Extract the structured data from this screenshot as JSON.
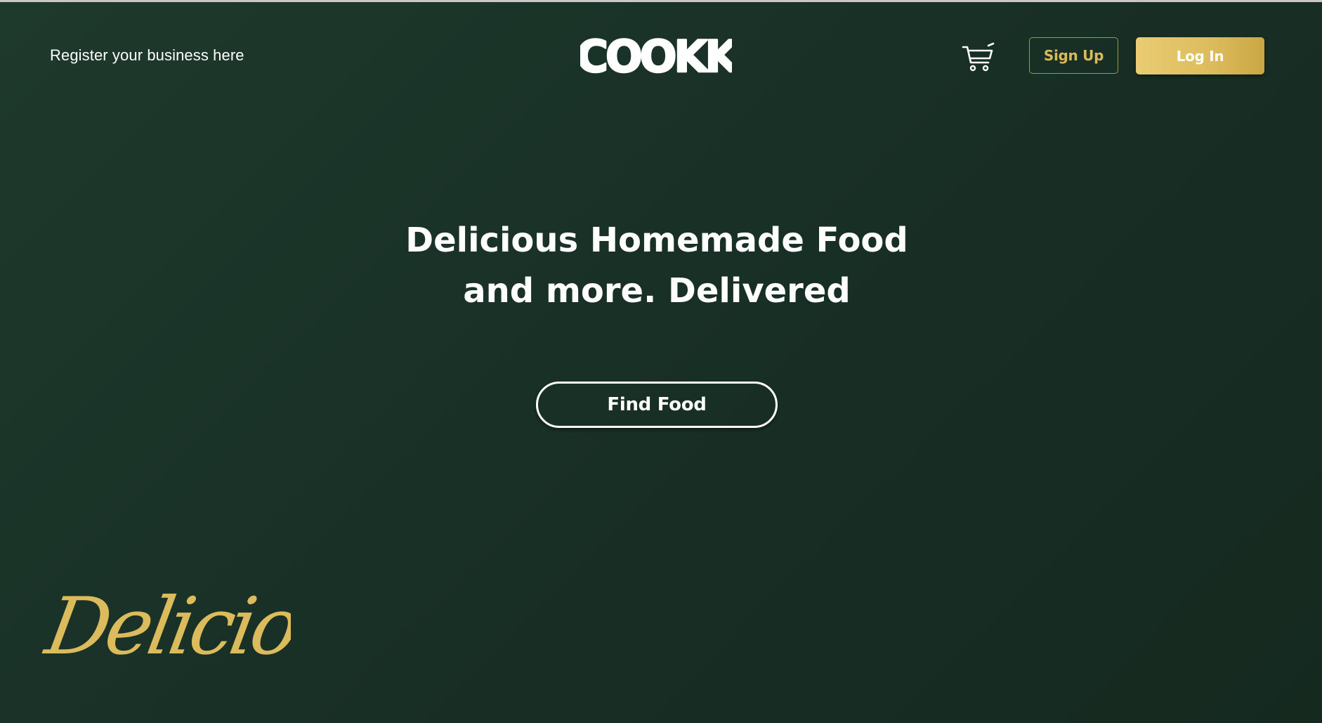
{
  "header": {
    "register_link": "Register your business here",
    "logo_text": "COOKK",
    "cart_icon": "shopping-cart-icon",
    "signup_label": "Sign Up",
    "login_label": "Log In"
  },
  "hero": {
    "headline_line1": "Delicious Homemade Food",
    "headline_line2": "and more. Delivered",
    "cta_label": "Find Food"
  },
  "decoration": {
    "script_word": "Delicious"
  },
  "colors": {
    "background_start": "#1e3a2c",
    "background_end": "#15291f",
    "gold_accent": "#dcbb5c",
    "text": "#ffffff"
  }
}
